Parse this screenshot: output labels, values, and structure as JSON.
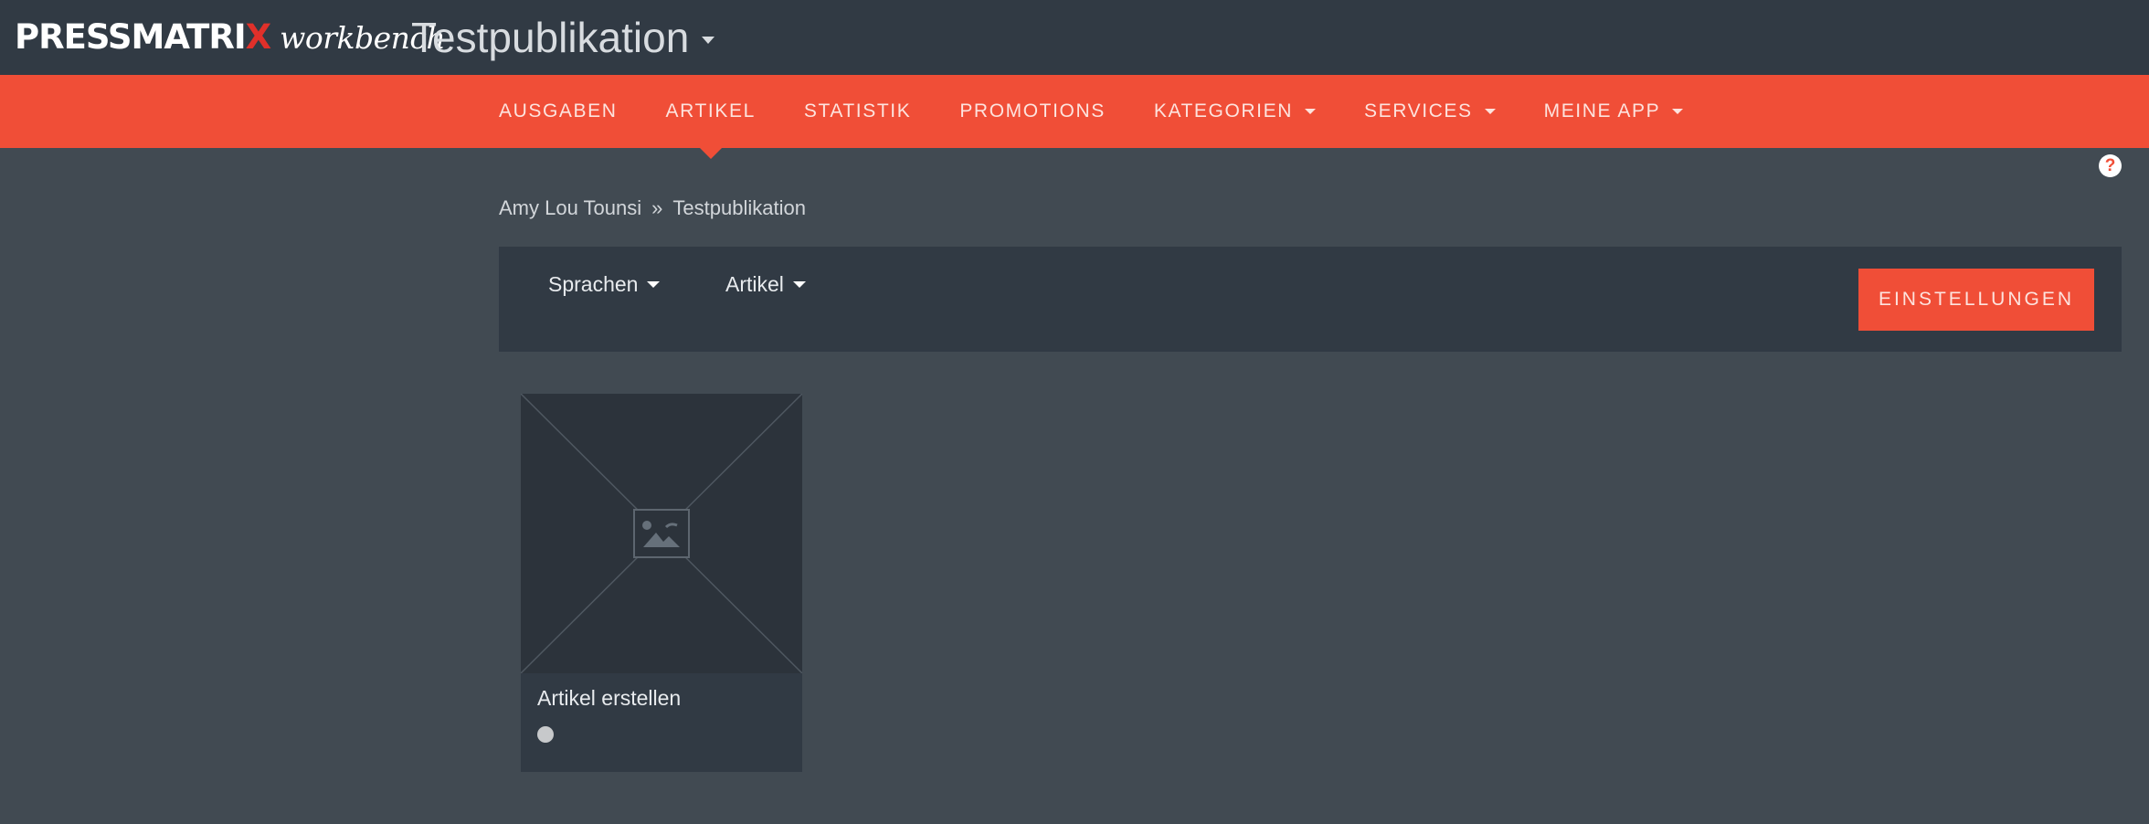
{
  "app": {
    "logo_main_1": "PRESSMATRI",
    "logo_main_2": "X",
    "logo_sub": "workbench",
    "publication_title": "Testpublikation"
  },
  "nav": {
    "items": [
      {
        "label": "AUSGABEN",
        "dropdown": false,
        "active": false
      },
      {
        "label": "ARTIKEL",
        "dropdown": false,
        "active": true
      },
      {
        "label": "STATISTIK",
        "dropdown": false,
        "active": false
      },
      {
        "label": "PROMOTIONS",
        "dropdown": false,
        "active": false
      },
      {
        "label": "KATEGORIEN",
        "dropdown": true,
        "active": false
      },
      {
        "label": "SERVICES",
        "dropdown": true,
        "active": false
      },
      {
        "label": "MEINE APP",
        "dropdown": true,
        "active": false
      }
    ],
    "help_icon": "?"
  },
  "breadcrumb": {
    "items": [
      "Amy Lou Tounsi",
      "Testpublikation"
    ],
    "separator": "»"
  },
  "toolbar": {
    "languages_label": "Sprachen",
    "articles_label": "Artikel",
    "settings_label": "EINSTELLUNGEN"
  },
  "cards": [
    {
      "title": "Artikel erstellen",
      "icon": "image-placeholder-icon",
      "status_color": "#c7c9cb"
    }
  ],
  "colors": {
    "accent": "#f04e37",
    "topbar": "#313a44",
    "background": "#414a52",
    "logo_x": "#e0302a"
  }
}
